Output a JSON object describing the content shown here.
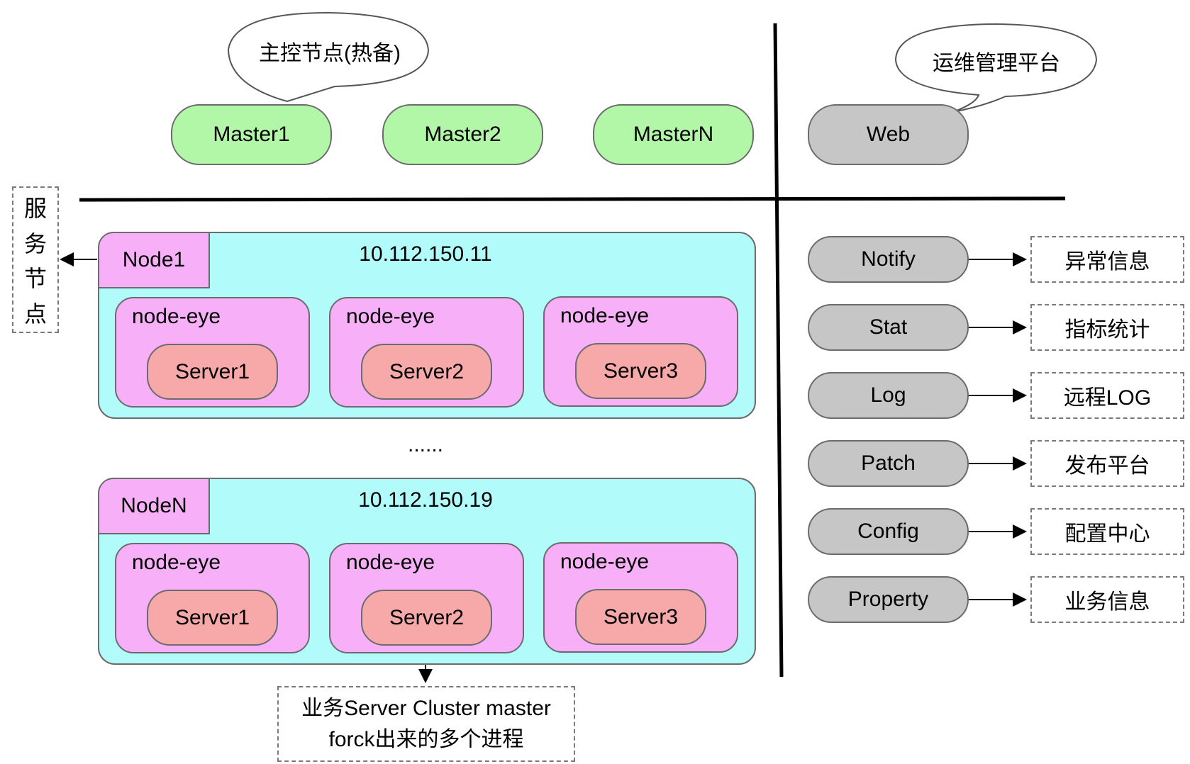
{
  "masters": {
    "callout": "主控节点(热备)",
    "items": [
      "Master1",
      "Master2",
      "MasterN"
    ]
  },
  "web": {
    "callout": "运维管理平台",
    "label": "Web"
  },
  "service_node_label": [
    "服",
    "务",
    "节",
    "点"
  ],
  "nodes": [
    {
      "name": "Node1",
      "ip": "10.112.150.11",
      "eyes": [
        {
          "label": "node-eye",
          "server": "Server1"
        },
        {
          "label": "node-eye",
          "server": "Server2"
        },
        {
          "label": "node-eye",
          "server": "Server3"
        }
      ]
    },
    {
      "name": "NodeN",
      "ip": "10.112.150.19",
      "eyes": [
        {
          "label": "node-eye",
          "server": "Server1"
        },
        {
          "label": "node-eye",
          "server": "Server2"
        },
        {
          "label": "node-eye",
          "server": "Server3"
        }
      ]
    }
  ],
  "ellipsis": "......",
  "fork_note": {
    "line1": "业务Server Cluster master",
    "line2": "forck出来的多个进程"
  },
  "services": [
    {
      "label": "Notify",
      "target": "异常信息"
    },
    {
      "label": "Stat",
      "target": "指标统计"
    },
    {
      "label": "Log",
      "target": "远程LOG"
    },
    {
      "label": "Patch",
      "target": "发布平台"
    },
    {
      "label": "Config",
      "target": "配置中心"
    },
    {
      "label": "Property",
      "target": "业务信息"
    }
  ],
  "colors": {
    "master_fill": "#b2f7a8",
    "service_fill": "#c6c6c6",
    "node_fill": "#b2fbfb",
    "eye_fill": "#f7b0f8",
    "server_fill": "#f7a8a8"
  }
}
